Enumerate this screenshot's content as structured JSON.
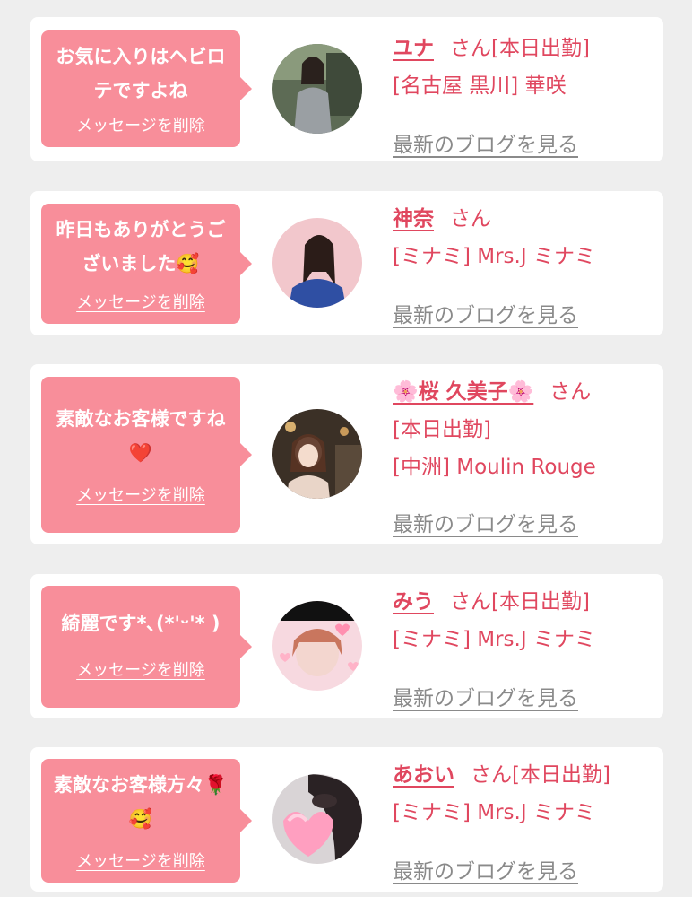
{
  "delete_label": "メッセージを削除",
  "blog_label": "最新のブログを見る",
  "honorific": "さん",
  "colors": {
    "bubble": "#f88e9a",
    "name": "#e0475f",
    "blog_link": "#8a8a8a",
    "card": "#ffffff",
    "background": "#eeeeee"
  },
  "cards": [
    {
      "message": "お気に入りはヘビロテですよね",
      "name": "ユナ",
      "status": "[本日出勤]",
      "shop": "[名古屋 黒川] 華咲"
    },
    {
      "message": "昨日もありがとうございました🥰",
      "name": "神奈",
      "status": "",
      "shop": "[ミナミ] Mrs.J ミナミ"
    },
    {
      "message": "素敵なお客様ですね❤️",
      "name": "🌸桜 久美子🌸",
      "status": "[本日出勤]",
      "shop": "[中洲] Moulin Rouge"
    },
    {
      "message": "綺麗です*､(*'ᵕ'* )",
      "name": "みう",
      "status": "[本日出勤]",
      "shop": "[ミナミ] Mrs.J ミナミ"
    },
    {
      "message": "素敵なお客様方々🌹🥰",
      "name": "あおい",
      "status": "[本日出勤]",
      "shop": "[ミナミ] Mrs.J ミナミ"
    }
  ]
}
